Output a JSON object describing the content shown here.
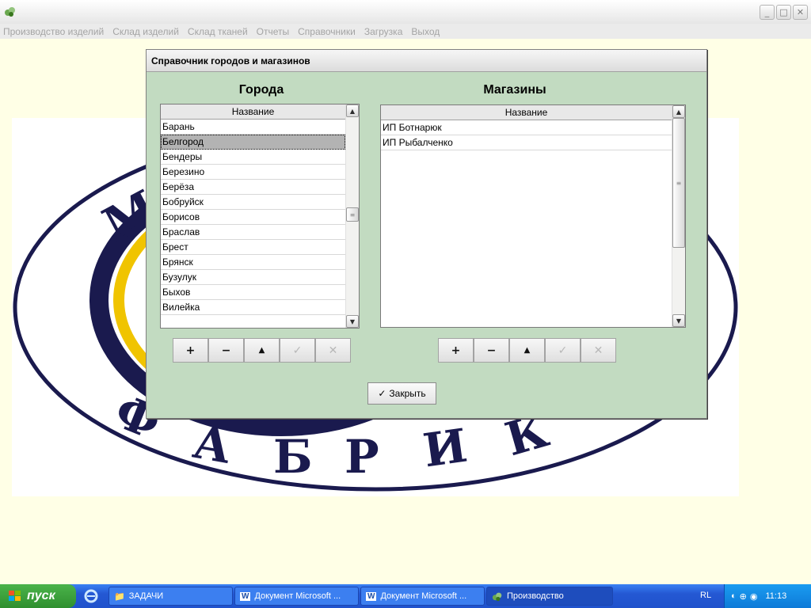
{
  "menu": [
    "Производство изделий",
    "Склад изделий",
    "Склад тканей",
    "Отчеты",
    "Справочники",
    "Загрузка",
    "Выход"
  ],
  "window_buttons": [
    "minimize-icon",
    "maximize-icon",
    "close-icon"
  ],
  "background_logo": {
    "top_letter": "М",
    "bottom_text": [
      "Ф",
      "А",
      "Б",
      "Р",
      "И",
      "К"
    ],
    "colors": {
      "navy": "#1a1a4e",
      "gold": "#f0c400"
    }
  },
  "dialog": {
    "title": "Справочник городов и магазинов",
    "cities": {
      "heading": "Города",
      "column": "Название",
      "rows": [
        "Барань",
        "Белгород",
        "Бендеры",
        "Березино",
        "Берёза",
        "Бобруйск",
        "Борисов",
        "Браслав",
        "Брест",
        "Брянск",
        "Бузулук",
        "Быхов",
        "Вилейка"
      ],
      "selected": "Белгород"
    },
    "shops": {
      "heading": "Магазины",
      "column": "Название",
      "rows": [
        "ИП Ботнарюк",
        "ИП Рыбалченко"
      ]
    },
    "toolbar": {
      "add": "+",
      "remove": "−",
      "up": "▲",
      "confirm": "✓",
      "cancel": "✕"
    },
    "close_button": {
      "check": "✓",
      "label": "Закрыть"
    }
  },
  "taskbar": {
    "start": "пуск",
    "tasks": [
      "ЗАДАЧИ",
      "Документ Microsoft ...",
      "Документ Microsoft ...",
      "Производство"
    ],
    "lang": "RL",
    "clock": "11:13"
  }
}
